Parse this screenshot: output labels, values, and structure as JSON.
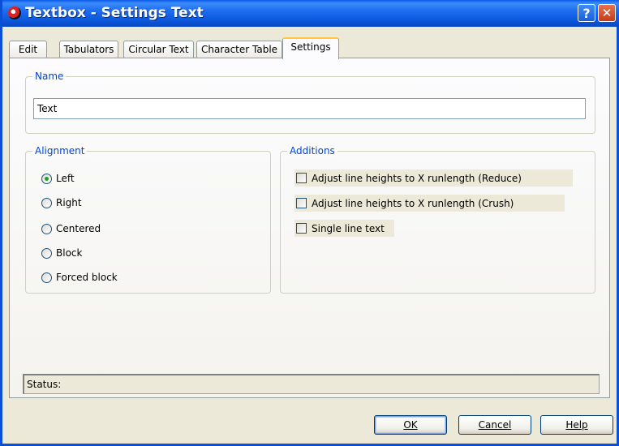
{
  "window": {
    "title": "Textbox - Settings Text",
    "help_glyph": "?",
    "close_glyph": "✕",
    "icons": [
      "app-icon",
      "help-icon",
      "close-icon"
    ]
  },
  "tabs": [
    {
      "label": "Edit",
      "active": false
    },
    {
      "label": "Tabulators",
      "active": false
    },
    {
      "label": "Circular Text",
      "active": false
    },
    {
      "label": "Character Table",
      "active": false
    },
    {
      "label": "Settings",
      "active": true
    }
  ],
  "name_group": {
    "label": "Name",
    "value": "Text"
  },
  "alignment": {
    "label": "Alignment",
    "options": [
      {
        "label": "Left",
        "checked": true
      },
      {
        "label": "Right",
        "checked": false
      },
      {
        "label": "Centered",
        "checked": false
      },
      {
        "label": "Block",
        "checked": false
      },
      {
        "label": "Forced block",
        "checked": false
      }
    ]
  },
  "additions": {
    "label": "Additions",
    "options": [
      {
        "label": "Adjust line heights to X runlength (Reduce)",
        "checked": false
      },
      {
        "label": "Adjust line heights to X runlength (Crush)",
        "checked": false
      },
      {
        "label": "Single line text",
        "checked": false
      }
    ]
  },
  "status": {
    "text": "Status:"
  },
  "buttons": {
    "ok": "OK",
    "cancel": "Cancel",
    "help": "Help"
  },
  "colors": {
    "titlebar": "#0A55D8",
    "dialog_bg": "#ECE9D8",
    "group_label": "#0046D5",
    "active_tab_highlight": "#FFC83C",
    "radio_dot": "#21A121"
  }
}
